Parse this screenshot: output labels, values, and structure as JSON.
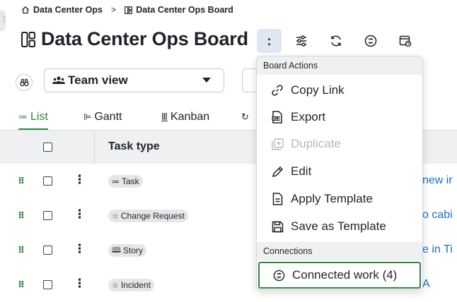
{
  "breadcrumb": {
    "items": [
      "Data Center Ops",
      "Data Center Ops Board"
    ],
    "separator": ">"
  },
  "board": {
    "title": "Data Center Ops Board",
    "more_label": ":"
  },
  "toolbar": {
    "icons": [
      "settings-sliders-icon",
      "refresh-icon",
      "connected-work-icon",
      "board-calendar-icon"
    ]
  },
  "view": {
    "selected": "Team view"
  },
  "tabs": [
    {
      "label": "List",
      "active": true
    },
    {
      "label": "Gantt",
      "active": false
    },
    {
      "label": "Kanban",
      "active": false
    }
  ],
  "table": {
    "header_task_type": "Task type",
    "rows": [
      {
        "type": "Task",
        "icon": "task-icon",
        "title_fragment": "new ir"
      },
      {
        "type": "Change Request",
        "icon": "star-icon",
        "title_fragment": "o cabi"
      },
      {
        "type": "Story",
        "icon": "book-icon",
        "title_fragment": "e in Ti"
      },
      {
        "type": "Incident",
        "icon": "star-icon",
        "title_fragment": "A"
      }
    ]
  },
  "menu": {
    "sections": [
      {
        "header": "Board Actions",
        "items": [
          {
            "label": "Copy Link",
            "icon": "link-icon",
            "disabled": false
          },
          {
            "label": "Export",
            "icon": "xls-export-icon",
            "disabled": false
          },
          {
            "label": "Duplicate",
            "icon": "duplicate-icon",
            "disabled": true
          },
          {
            "label": "Edit",
            "icon": "pencil-icon",
            "disabled": false
          },
          {
            "label": "Apply Template",
            "icon": "template-icon",
            "disabled": false
          },
          {
            "label": "Save as Template",
            "icon": "save-icon",
            "disabled": false
          }
        ]
      },
      {
        "header": "Connections",
        "items": [
          {
            "label": "Connected work (4)",
            "icon": "connected-work-icon",
            "disabled": false,
            "focused": true
          }
        ]
      }
    ]
  },
  "colors": {
    "accent": "#2e8540",
    "link": "#1d6fb8",
    "header_bg": "#eef0f2",
    "kebab_bg": "#dfe7f3"
  }
}
